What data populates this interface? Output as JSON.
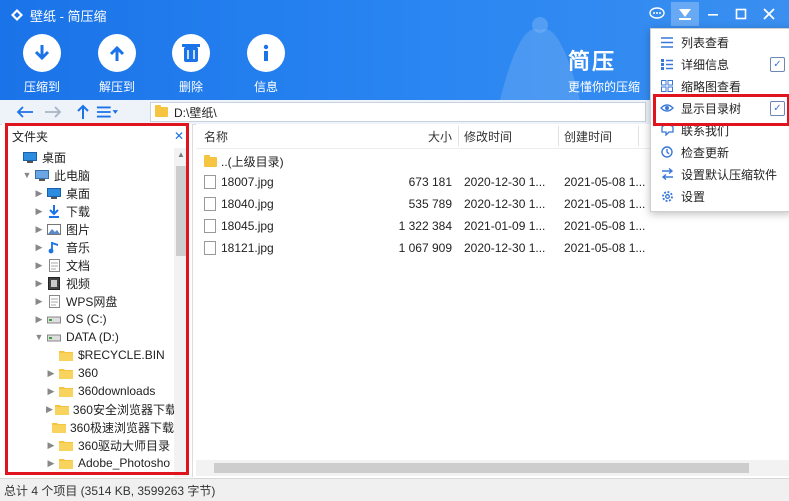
{
  "window": {
    "title": "壁纸 - 简压缩"
  },
  "toolbar": {
    "compress": "压缩到",
    "extract": "解压到",
    "delete": "删除",
    "info": "信息"
  },
  "brand": {
    "name": "简压",
    "slogan": "更懂你的压缩"
  },
  "address": {
    "path": "D:\\壁纸\\"
  },
  "sidebar": {
    "title": "文件夹",
    "tree": [
      {
        "label": "桌面",
        "icon": "desktop-icon"
      },
      {
        "label": "此电脑",
        "icon": "computer-icon"
      },
      {
        "label": "桌面",
        "icon": "desktop-icon"
      },
      {
        "label": "下载",
        "icon": "download-icon"
      },
      {
        "label": "图片",
        "icon": "pictures-icon"
      },
      {
        "label": "音乐",
        "icon": "music-icon"
      },
      {
        "label": "文档",
        "icon": "document-icon"
      },
      {
        "label": "视频",
        "icon": "video-icon"
      },
      {
        "label": "WPS网盘",
        "icon": "document-icon"
      },
      {
        "label": "OS (C:)",
        "icon": "drive-icon"
      },
      {
        "label": "DATA (D:)",
        "icon": "drive-icon"
      },
      {
        "label": "$RECYCLE.BIN",
        "icon": "folder-icon"
      },
      {
        "label": "360",
        "icon": "folder-icon"
      },
      {
        "label": "360downloads",
        "icon": "folder-icon"
      },
      {
        "label": "360安全浏览器下载",
        "icon": "folder-icon"
      },
      {
        "label": "360极速浏览器下载",
        "icon": "folder-icon"
      },
      {
        "label": "360驱动大师目录",
        "icon": "folder-icon"
      },
      {
        "label": "Adobe_Photosho",
        "icon": "folder-icon"
      }
    ]
  },
  "filelist": {
    "columns": {
      "name": "名称",
      "size": "大小",
      "modified": "修改时间",
      "created": "创建时间"
    },
    "parent": "..(上级目录)",
    "rows": [
      {
        "name": "18007.jpg",
        "size": "673 181",
        "modified": "2020-12-30 1...",
        "created": "2021-05-08 1..."
      },
      {
        "name": "18040.jpg",
        "size": "535 789",
        "modified": "2020-12-30 1...",
        "created": "2021-05-08 1..."
      },
      {
        "name": "18045.jpg",
        "size": "1 322 384",
        "modified": "2021-01-09 1...",
        "created": "2021-05-08 1..."
      },
      {
        "name": "18121.jpg",
        "size": "1 067 909",
        "modified": "2020-12-30 1...",
        "created": "2021-05-08 1..."
      }
    ]
  },
  "status": {
    "text": "总计 4 个项目 (3514 KB, 3599263 字节)"
  },
  "menu": {
    "items": [
      {
        "label": "列表查看",
        "icon": "list-icon",
        "checked": false
      },
      {
        "label": "详细信息",
        "icon": "details-icon",
        "checked": true
      },
      {
        "label": "缩略图查看",
        "icon": "thumbnail-icon",
        "checked": false
      },
      {
        "label": "显示目录树",
        "icon": "eye-icon",
        "checked": true
      },
      {
        "label": "联系我们",
        "icon": "contact-icon",
        "checked": false
      },
      {
        "label": "检查更新",
        "icon": "update-icon",
        "checked": false
      },
      {
        "label": "设置默认压缩软件",
        "icon": "swap-icon",
        "checked": false
      },
      {
        "label": "设置",
        "icon": "gear-icon",
        "checked": false
      }
    ]
  },
  "colors": {
    "accent": "#1a73e8",
    "highlight": "#e0141e"
  }
}
